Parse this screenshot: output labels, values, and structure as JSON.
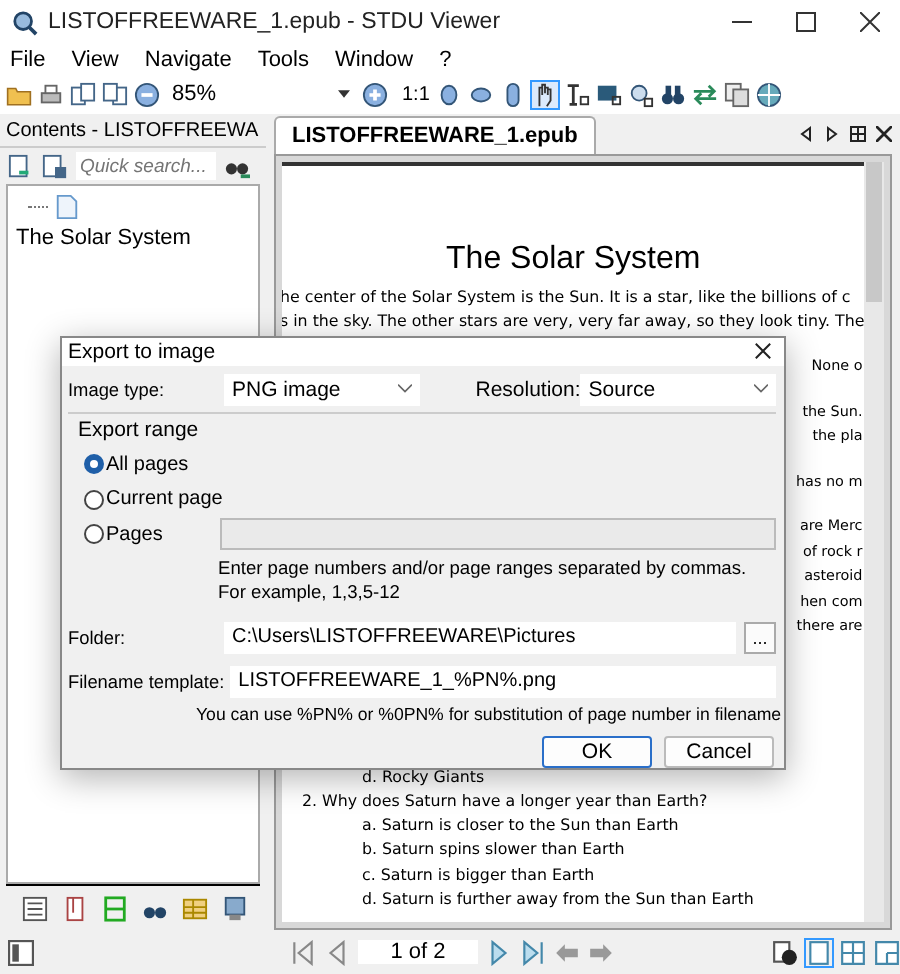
{
  "window": {
    "title": "LISTOFFREEWARE_1.epub - STDU Viewer"
  },
  "menu": [
    "File",
    "View",
    "Navigate",
    "Tools",
    "Window",
    "?"
  ],
  "toolbar": {
    "zoom": "85%",
    "actual_size": "1:1"
  },
  "contents_panel": {
    "title": "Contents - LISTOFFREEWA",
    "search_placeholder": "Quick search...",
    "tree": [
      {
        "label": "The Solar System"
      }
    ]
  },
  "document_tab": {
    "label": "LISTOFFREEWARE_1.epub"
  },
  "document": {
    "heading": "The Solar System",
    "lines": [
      "he center of the Solar System is the Sun. It is a star, like the billions of c",
      "s in the sky. The other stars are very, very far away, so they look tiny. The"
    ],
    "fragment_groups": [
      [
        "None o"
      ],
      [
        "the Sun.",
        "the pla"
      ],
      [
        "has no m"
      ],
      [
        "are Merc",
        "of rock r",
        "asteroid",
        "hen com",
        "there are"
      ]
    ],
    "quiz_lines": [
      {
        "text": "d. Rocky Giants",
        "kind": "answer"
      },
      {
        "text": "2. Why does Saturn have a longer year than Earth?",
        "kind": "question"
      },
      {
        "text": "a. Saturn is closer to the Sun than Earth",
        "kind": "answer"
      },
      {
        "text": "b. Saturn spins slower than Earth",
        "kind": "answer"
      },
      {
        "text": "c. Saturn is bigger than Earth",
        "kind": "answer"
      },
      {
        "text": "d. Saturn is further away from the Sun than Earth",
        "kind": "answer"
      }
    ]
  },
  "status_bar": {
    "page": "1 of 2"
  },
  "dialog": {
    "title": "Export to image",
    "image_type_label": "Image type:",
    "image_type": "PNG image",
    "resolution_label": "Resolution:",
    "resolution": "Source",
    "range_title": "Export range",
    "range_options": [
      {
        "label": "All pages",
        "selected": true
      },
      {
        "label": "Current page",
        "selected": false
      },
      {
        "label": "Pages",
        "selected": false
      }
    ],
    "pages_hint": [
      "Enter page numbers and/or page ranges separated by commas.",
      "For example, 1,3,5-12"
    ],
    "folder_label": "Folder:",
    "folder": "C:\\Users\\LISTOFFREEWARE\\Pictures",
    "browse": "...",
    "filename_label": "Filename template:",
    "filename": "LISTOFFREEWARE_1_%PN%.png",
    "filename_hint": "You can use %PN% or %0PN% for substitution of page number in filename",
    "buttons": [
      "OK",
      "Cancel"
    ]
  }
}
